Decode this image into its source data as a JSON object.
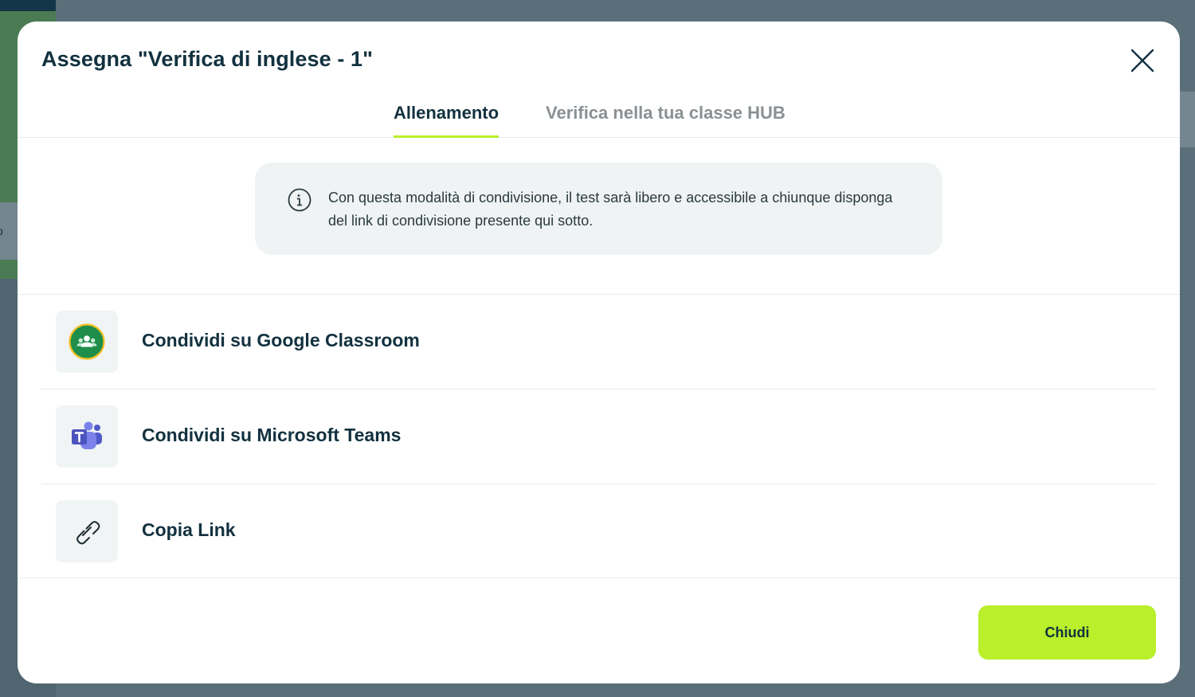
{
  "modal": {
    "title": "Assegna \"Verifica di inglese - 1\"",
    "close_icon": "close-icon"
  },
  "tabs": [
    {
      "label": "Allenamento",
      "active": true
    },
    {
      "label": "Verifica nella tua classe HUB",
      "active": false
    }
  ],
  "info": {
    "icon": "info-icon",
    "text": "Con questa modalità di condivisione, il test sarà libero e accessibile a chiunque disponga del link di condivisione presente qui sotto."
  },
  "share_options": [
    {
      "label": "Condividi su Google Classroom",
      "icon": "google-classroom-icon"
    },
    {
      "label": "Condividi su Microsoft Teams",
      "icon": "microsoft-teams-icon"
    },
    {
      "label": "Copia Link",
      "icon": "link-icon"
    }
  ],
  "footer": {
    "close_label": "Chiudi"
  },
  "colors": {
    "accent": "#b9ef2b",
    "title": "#12313f",
    "tab_inactive": "#8a9093",
    "overlay": "#5a6f79"
  }
}
